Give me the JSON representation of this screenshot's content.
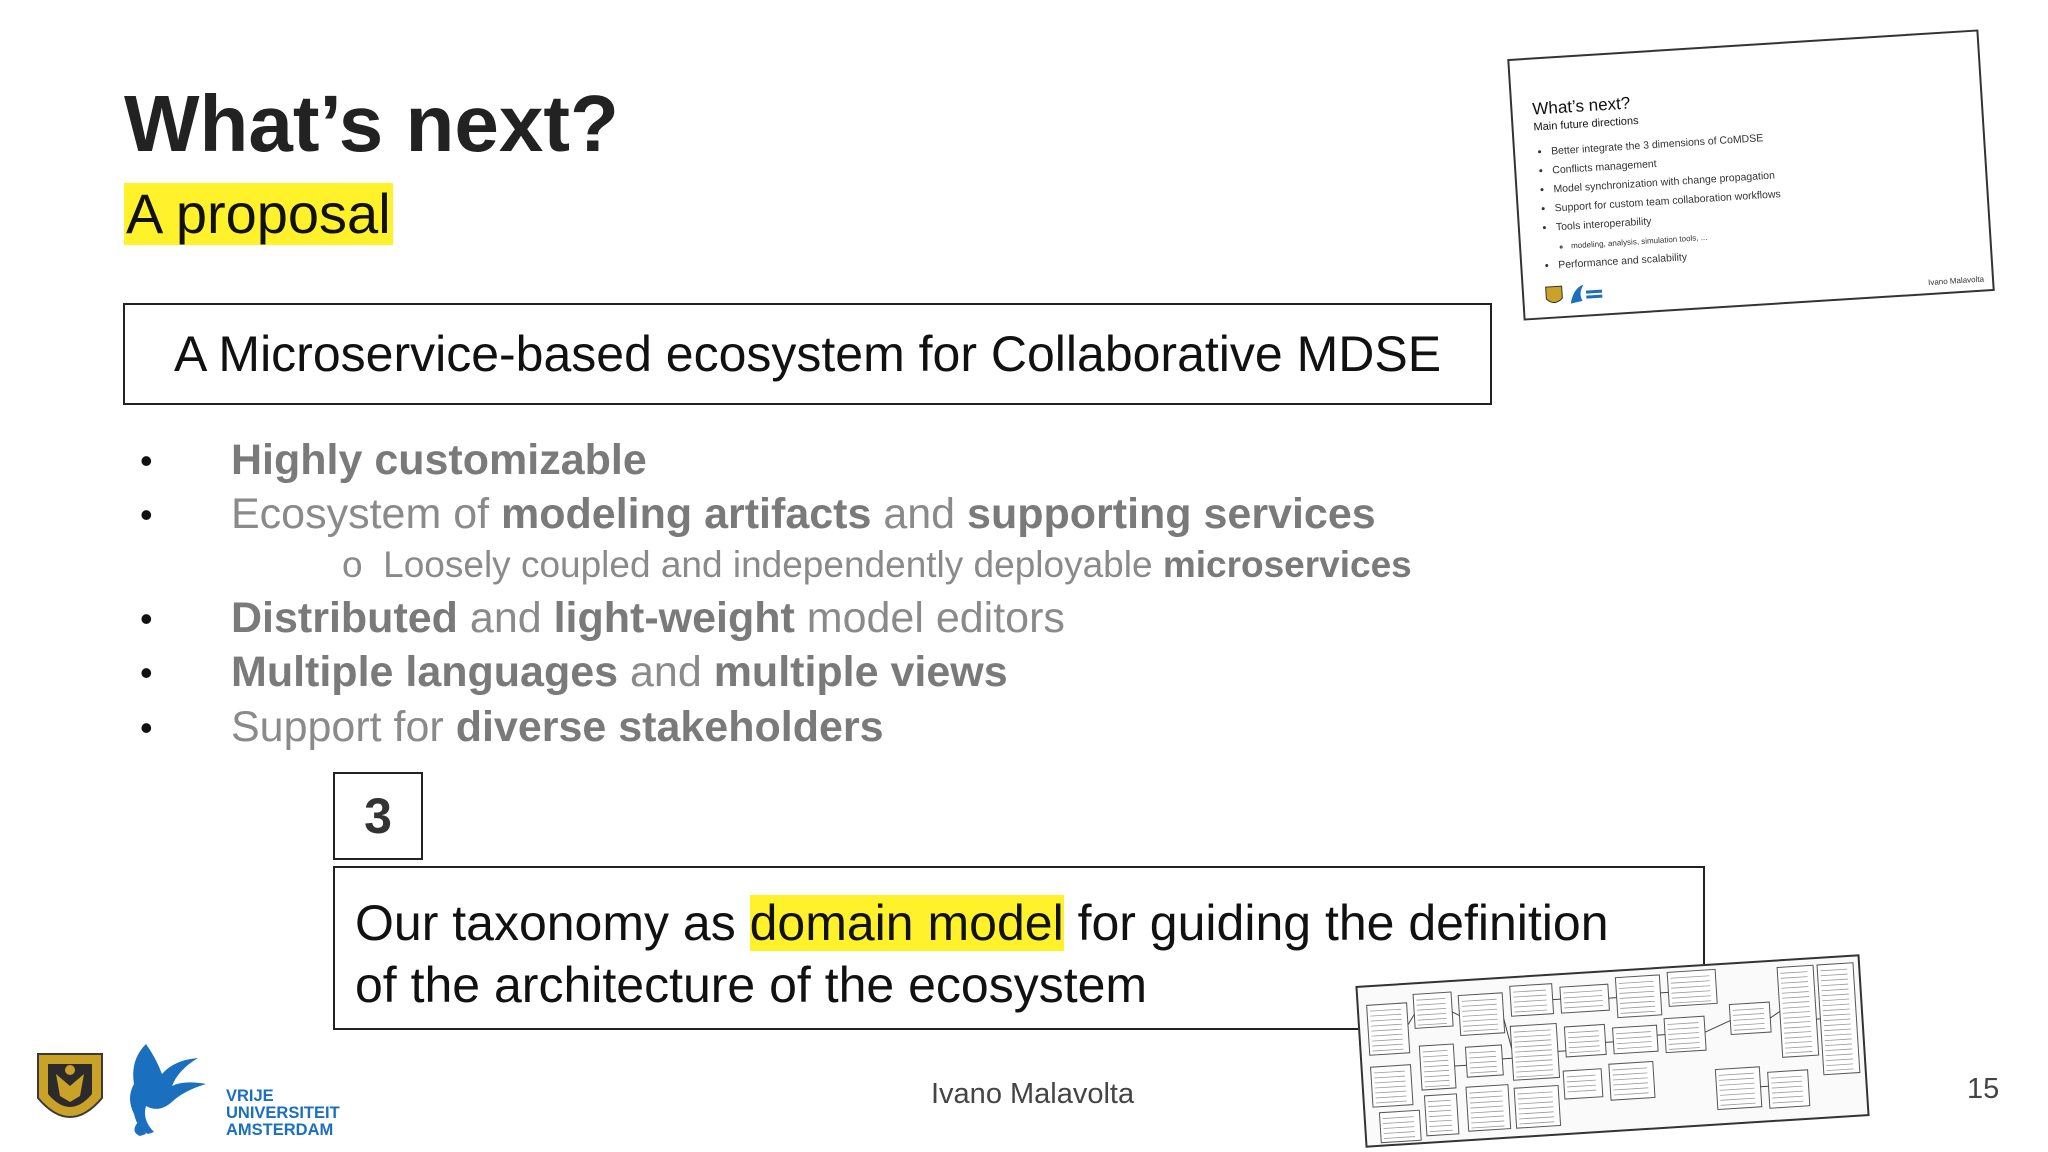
{
  "slide": {
    "title": "What’s next?",
    "subtitle": "A proposal",
    "ecosystem_box": "A Microservice-based ecosystem for Collaborative MDSE",
    "bullets": [
      {
        "parts": [
          {
            "t": "Highly customizable",
            "b": true
          }
        ]
      },
      {
        "parts": [
          {
            "t": "Ecosystem of ",
            "b": false
          },
          {
            "t": "modeling artifacts",
            "b": true
          },
          {
            "t": " and ",
            "b": false
          },
          {
            "t": "supporting services",
            "b": true
          }
        ]
      },
      {
        "parts": [
          {
            "t": "Distributed",
            "b": true
          },
          {
            "t": " and ",
            "b": false
          },
          {
            "t": "light-weight",
            "b": true
          },
          {
            "t": " model editors",
            "b": false
          }
        ]
      },
      {
        "parts": [
          {
            "t": "Multiple languages",
            "b": true
          },
          {
            "t": " and ",
            "b": false
          },
          {
            "t": "multiple views",
            "b": true
          }
        ]
      },
      {
        "parts": [
          {
            "t": "Support for ",
            "b": false
          },
          {
            "t": "diverse stakeholders",
            "b": true
          }
        ]
      }
    ],
    "bullet_marker": "•",
    "sub_bullet": {
      "marker": "o",
      "text": "Loosely coupled and independently deployable ",
      "bold": "microservices"
    },
    "number_box": "3",
    "taxonomy": {
      "before": "Our taxonomy as ",
      "highlight": "domain model",
      "after": " for guiding the definition",
      "line2": "of the architecture of the ecosystem"
    },
    "footer_name": "Ivano Malavolta",
    "page_number": "15",
    "colors": {
      "highlight": "#fff22a",
      "vu_blue": "#1a6fbf"
    }
  },
  "logo": {
    "vu_lines": [
      "VRIJE",
      "UNIVERSITEIT",
      "AMSTERDAM"
    ],
    "icons": [
      "crest-icon",
      "griffin-icon"
    ]
  },
  "thumbnail": {
    "title": "What’s next?",
    "subtitle": "Main future directions",
    "items": [
      "Better integrate the 3 dimensions of CoMDSE",
      "Conflicts management",
      "Model synchronization with change propagation",
      "Support for custom team collaboration workflows",
      "Tools interoperability"
    ],
    "subitem": "modeling, analysis, simulation tools, ...",
    "last_item": "Performance and scalability",
    "name": "Ivano Malavolta"
  }
}
